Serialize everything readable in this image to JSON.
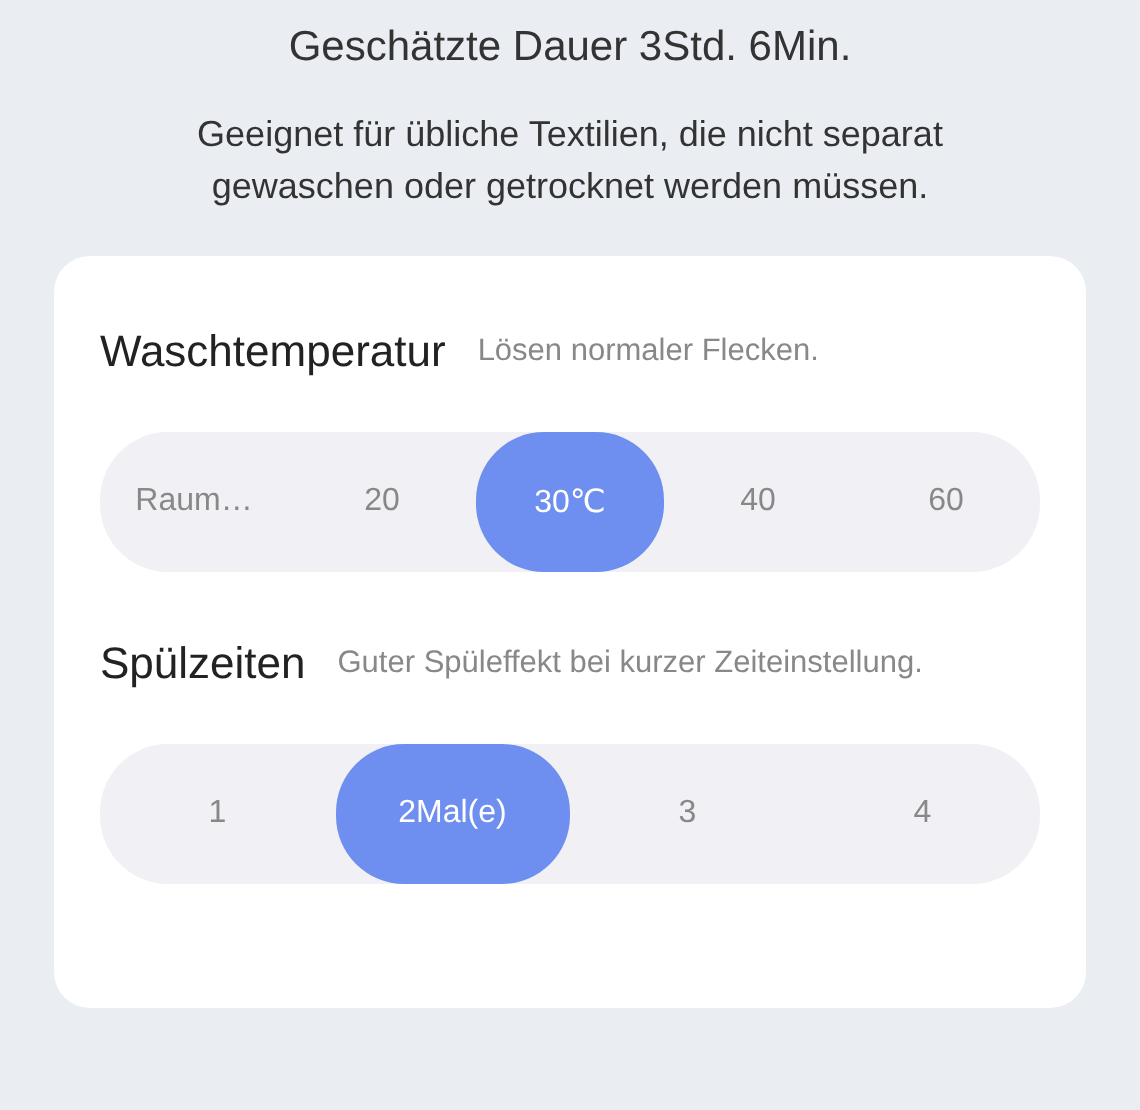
{
  "duration": "Geschätzte Dauer 3Std. 6Min.",
  "description": "Geeignet für übliche Textilien, die nicht separat gewaschen oder getrocknet werden müssen.",
  "settings": [
    {
      "title": "Waschtemperatur",
      "hint": "Lösen normaler Flecken.",
      "options": [
        {
          "label": "Raum…",
          "selected": false
        },
        {
          "label": "20",
          "selected": false
        },
        {
          "label": "30℃",
          "selected": true
        },
        {
          "label": "40",
          "selected": false
        },
        {
          "label": "60",
          "selected": false
        }
      ]
    },
    {
      "title": "Spülzeiten",
      "hint": "Guter Spüleffekt bei kurzer Zeiteinstellung.",
      "options": [
        {
          "label": "1",
          "selected": false
        },
        {
          "label": "2Mal(e)",
          "selected": true
        },
        {
          "label": "3",
          "selected": false
        },
        {
          "label": "4",
          "selected": false
        }
      ]
    }
  ]
}
